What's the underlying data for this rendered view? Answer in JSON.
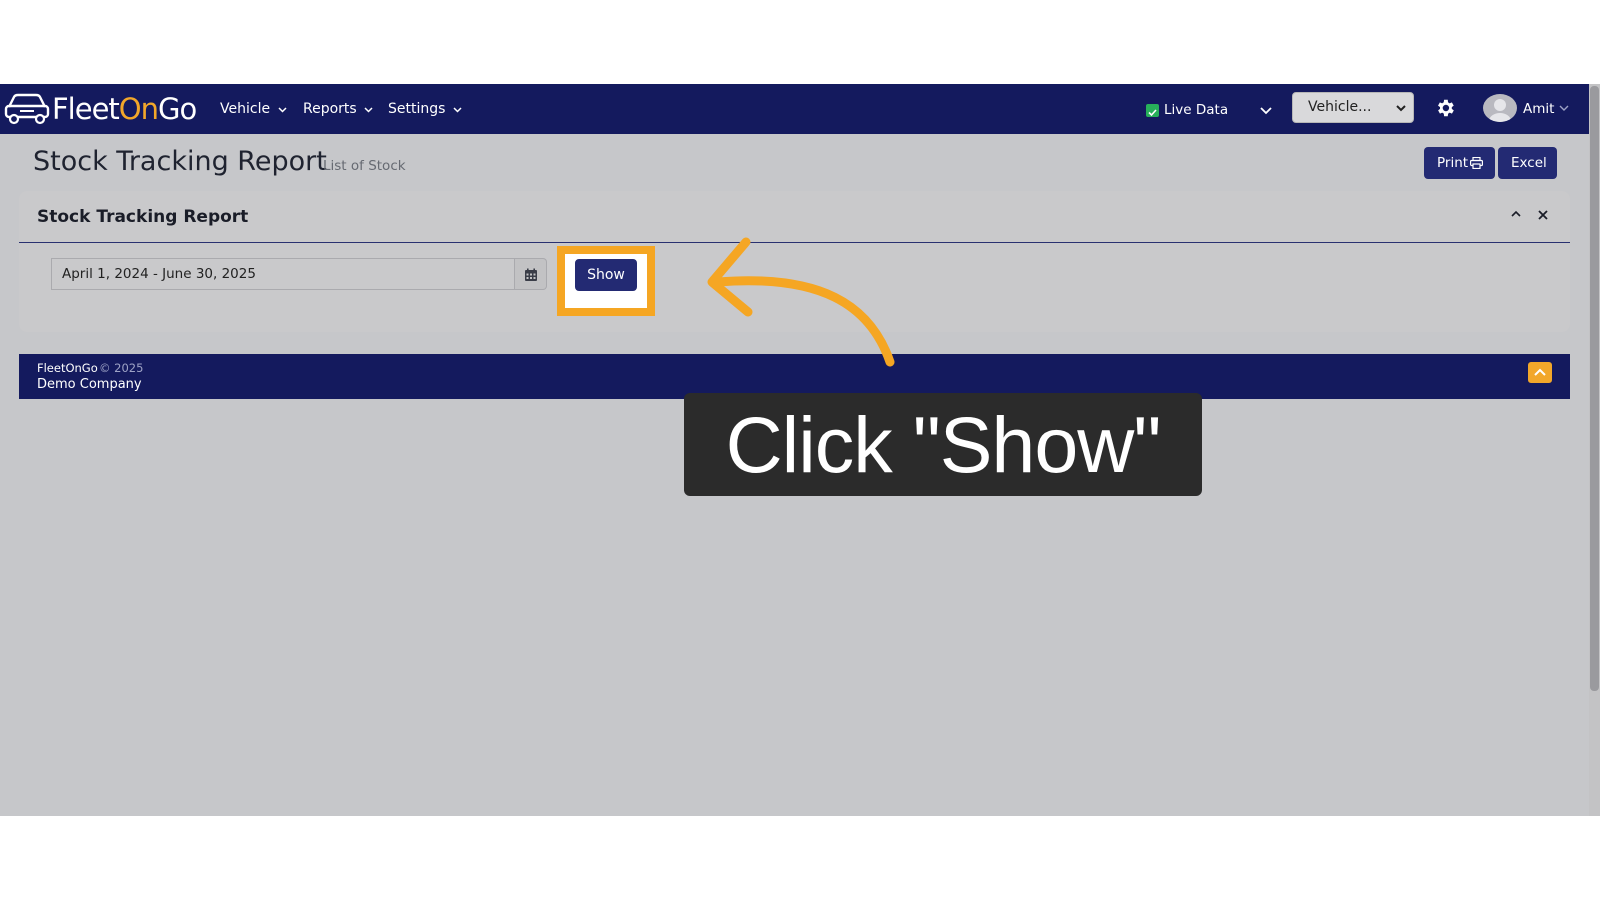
{
  "app": {
    "logo_text_a": "Fleet",
    "logo_text_b": "On",
    "logo_text_c": "Go",
    "brand_color": "#141a5e",
    "accent_color": "#f2a72a"
  },
  "navbar": {
    "menus": [
      {
        "label": "Vehicle"
      },
      {
        "label": "Reports"
      },
      {
        "label": "Settings"
      }
    ],
    "live_data_label": "Live Data",
    "live_data_checked": true,
    "vehicle_select_value": "Vehicle...",
    "user_name": "Amit"
  },
  "header": {
    "title": "Stock Tracking Report",
    "subtitle": "List of Stock",
    "print_label": "Print",
    "excel_label": "Excel"
  },
  "card": {
    "title": "Stock Tracking Report",
    "date_range_value": "April 1, 2024 - June 30, 2025",
    "show_label": "Show"
  },
  "footer": {
    "brand": "FleetOnGo",
    "copyright": "© 2025",
    "company": "Demo Company"
  },
  "annotation": {
    "callout_text": "Click \"Show\"",
    "highlight_color": "#f5a623"
  }
}
